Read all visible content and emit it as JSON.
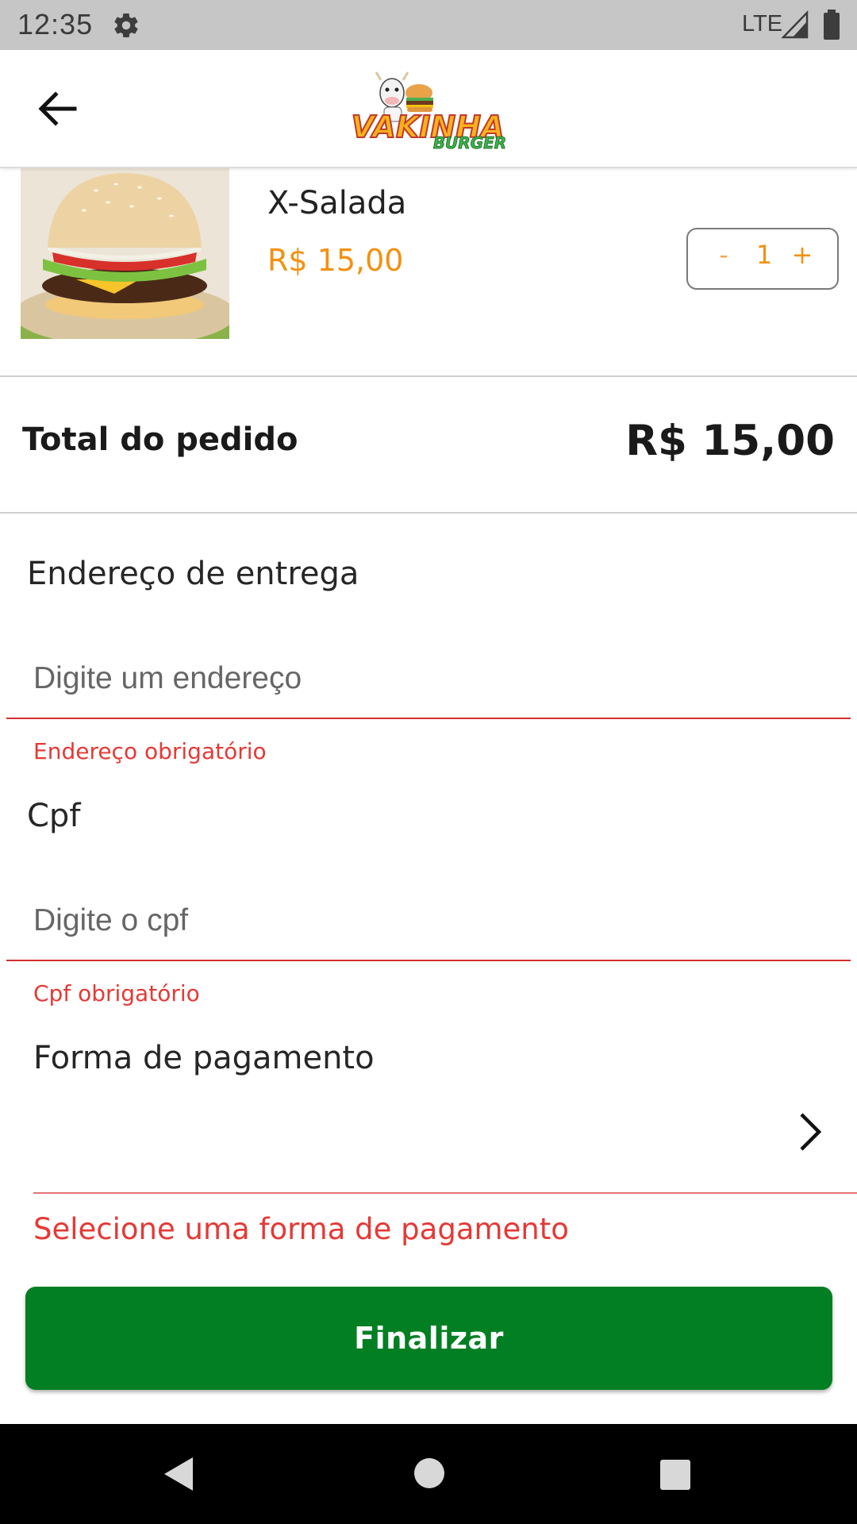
{
  "status_bar": {
    "time": "12:35",
    "network": "LTE",
    "icons": [
      "gear-icon",
      "signal-icon",
      "battery-icon"
    ]
  },
  "app_bar": {
    "back_icon": "arrow-left-icon",
    "logo": {
      "word1": "VAKINHA",
      "word2": "BURGER"
    }
  },
  "cart": {
    "items": [
      {
        "name": "X-Salada",
        "price": "R$ 15,00",
        "quantity": "1",
        "minus_label": "-",
        "plus_label": "+"
      }
    ]
  },
  "total": {
    "label": "Total do pedido",
    "value": "R$ 15,00"
  },
  "form": {
    "address": {
      "label": "Endereço de entrega",
      "placeholder": "Digite um endereço",
      "value": "",
      "error": "Endereço obrigatório"
    },
    "cpf": {
      "label": "Cpf",
      "placeholder": "Digite o cpf",
      "value": "",
      "error": "Cpf obrigatório"
    },
    "payment": {
      "label": "Forma de pagamento",
      "selected": "",
      "error": "Selecione uma forma de pagamento"
    }
  },
  "actions": {
    "finalize_label": "Finalizar"
  },
  "colors": {
    "accent_orange": "#f29111",
    "primary_green": "#017f22",
    "error_red": "#e53935",
    "status_bar": "#c6c6c6"
  }
}
